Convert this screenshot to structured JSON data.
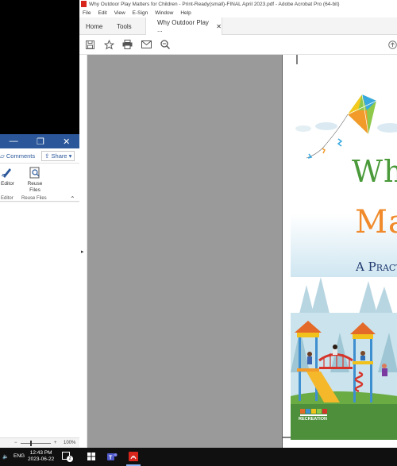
{
  "word": {
    "comments_label": "Comments",
    "share_label": "Share",
    "editor_label": "Editor",
    "reuse_files_label": "Reuse Files",
    "group_editor": "Editor",
    "group_reuse": "Reuse Files",
    "zoom_level": "100%"
  },
  "acrobat": {
    "window_title": "Why Outdoor Play Matters for Children - Print-Ready(small)-FINAL April 2023.pdf - Adobe Acrobat Pro (64-bit)",
    "menus": [
      "File",
      "Edit",
      "View",
      "E-Sign",
      "Window",
      "Help"
    ],
    "tabs": {
      "home": "Home",
      "tools": "Tools",
      "document": "Why Outdoor Play ..."
    },
    "toolbar_icons": [
      "save-icon",
      "bookmark-star-icon",
      "print-icon",
      "email-icon",
      "zoom-icon"
    ]
  },
  "pdf": {
    "title_line1": "Why",
    "title_line2": "Mat",
    "subtitle": "A Practi",
    "logo_text": "RECREATION"
  },
  "taskbar": {
    "language": "ENG",
    "time": "12:43 PM",
    "date": "2023-06-22",
    "notification_count": "2"
  },
  "colors": {
    "word_blue": "#2b579a",
    "acrobat_red": "#d9261c",
    "title_green": "#4a9a3a",
    "title_orange": "#f08a2a",
    "subtitle_navy": "#1f3a6e"
  }
}
